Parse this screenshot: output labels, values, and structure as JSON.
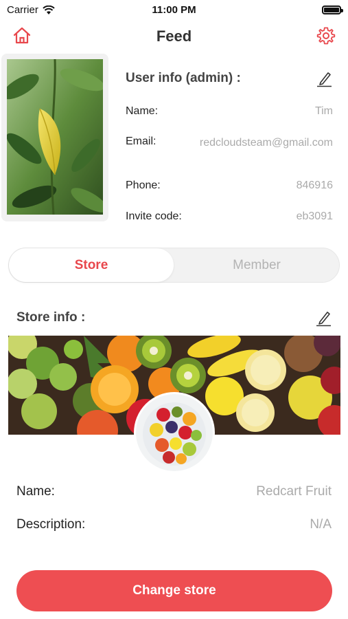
{
  "status_bar": {
    "carrier": "Carrier",
    "time": "11:00 PM"
  },
  "nav": {
    "title": "Feed"
  },
  "user_info": {
    "heading": "User info (admin) :",
    "fields": [
      {
        "label": "Name:",
        "value": "Tim"
      },
      {
        "label": "Email:",
        "value": "redcloudsteam@gmail.com"
      },
      {
        "label": "Phone:",
        "value": "846916"
      },
      {
        "label": "Invite code:",
        "value": "eb3091"
      }
    ]
  },
  "tabs": [
    {
      "label": "Store",
      "active": true
    },
    {
      "label": "Member",
      "active": false
    }
  ],
  "store_info": {
    "heading": "Store info :",
    "fields": [
      {
        "label": "Name:",
        "value": "Redcart Fruit"
      },
      {
        "label": "Description:",
        "value": "N/A"
      }
    ]
  },
  "actions": {
    "change_store": "Change store"
  },
  "colors": {
    "accent": "#ee4e52",
    "tab_active_text": "#e8474c",
    "muted_text": "#aaaaaa"
  },
  "icons": [
    "wifi-icon",
    "battery-icon",
    "home-icon",
    "gear-icon",
    "pencil-icon"
  ]
}
